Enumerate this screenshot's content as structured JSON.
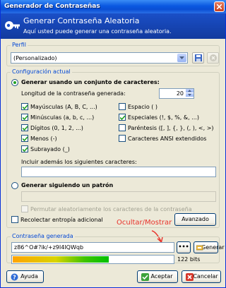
{
  "window": {
    "title": "Generador de Contraseñas"
  },
  "header": {
    "title": "Generar Contraseña Aleatoria",
    "subtitle": "Aquí usted puede generar una contraseña aleatoria."
  },
  "profile": {
    "legend": "Perfil",
    "selected": "(Personalizado)"
  },
  "config": {
    "legend": "Configuración actual",
    "charset_radio_label": "Generar usando un conjunto de caracteres:",
    "charset_selected": true,
    "length_label": "Longitud de la contraseña generada:",
    "length_value": "20",
    "options": [
      {
        "label": "Mayúsculas (A, B, C, ...)",
        "checked": true
      },
      {
        "label": "Espacio ( )",
        "checked": false
      },
      {
        "label": "Minúsculas (a, b, c, ...)",
        "checked": true
      },
      {
        "label": "Especiales (!, $, %, &, ...)",
        "checked": true
      },
      {
        "label": "Dígitos (0, 1, 2, ...)",
        "checked": true
      },
      {
        "label": "Paréntesis ([, ], {, }, (, ), <, >)",
        "checked": false
      },
      {
        "label": "Menos (-)",
        "checked": true
      },
      {
        "label": "Caracteres ANSI extendidos",
        "checked": false
      },
      {
        "label": "Subrayado (_)",
        "checked": true
      }
    ],
    "include_label": "Incluir además los siguientes caracteres:",
    "include_value": "",
    "pattern_radio_label": "Generar siguiendo un patrón",
    "pattern_value": "",
    "permute_label": "Permutar aleatoriamente los caracteres de la contraseña",
    "entropy_label": "Recolectar entropía adicional",
    "advanced_button": "Avanzado"
  },
  "generated": {
    "legend": "Contraseña generada",
    "annotation": "Ocultar/Mostrar",
    "annotation_color": "#e8312a",
    "value": "z86^O#?ik/+z9I4IQWqb",
    "toggle_button": "•••",
    "generate_button": "Generar",
    "quality_fraction": 0.6,
    "bits_label": "122 bits"
  },
  "footer": {
    "help_button": "Ayuda",
    "ok_button": "Aceptar",
    "cancel_button": "Cancelar"
  }
}
